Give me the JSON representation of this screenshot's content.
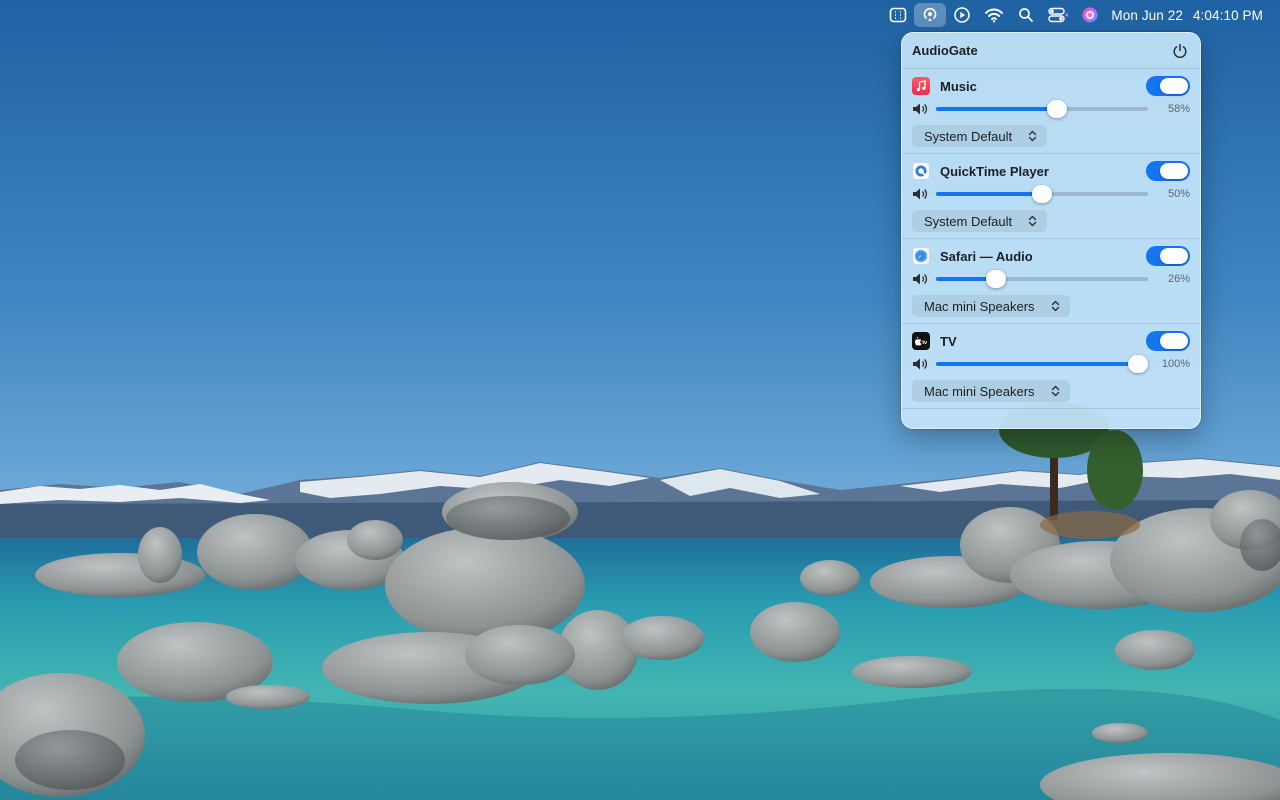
{
  "menubar": {
    "clock_date": "Mon Jun 22",
    "clock_time": "4:04:10 PM",
    "icons": [
      "display-icon",
      "audio-gate-icon",
      "play-icon",
      "wifi-icon",
      "search-icon",
      "control-center-icon",
      "siri-icon"
    ]
  },
  "panel": {
    "title": "AudioGate",
    "apps": [
      {
        "name": "Music",
        "icon": "music-icon",
        "icon_color": "#f0364e",
        "enabled": true,
        "volume": 58,
        "volume_label": "58%",
        "device": "System Default"
      },
      {
        "name": "QuickTime Player",
        "icon": "quicktime-icon",
        "icon_color": "#2d7be0",
        "enabled": true,
        "volume": 50,
        "volume_label": "50%",
        "device": "System Default"
      },
      {
        "name": "Safari — Audio",
        "icon": "safari-icon",
        "icon_color": "#2b8ef0",
        "enabled": true,
        "volume": 26,
        "volume_label": "26%",
        "device": "Mac mini Speakers"
      },
      {
        "name": "TV",
        "icon": "tv-icon",
        "icon_color": "#111111",
        "enabled": true,
        "volume": 100,
        "volume_label": "100%",
        "device": "Mac mini Speakers"
      }
    ]
  },
  "colors": {
    "accent": "#1574f0"
  }
}
